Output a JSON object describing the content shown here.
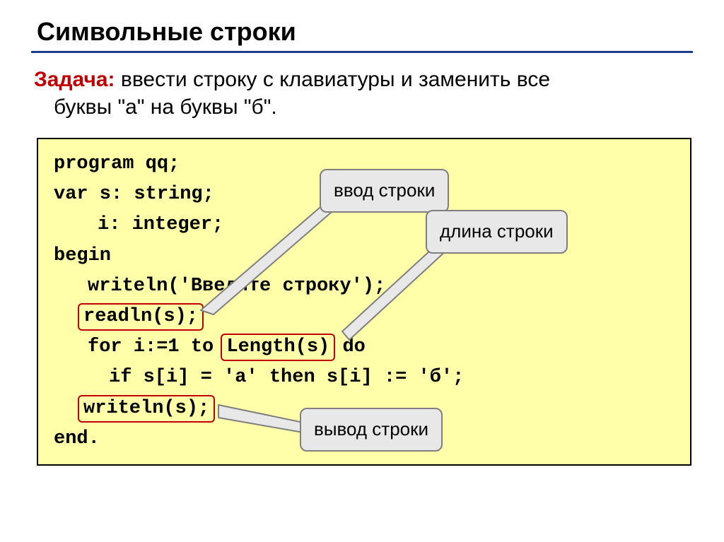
{
  "title": "Символьные строки",
  "task": {
    "label": "Задача:",
    "line1": " ввести строку с клавиатуры и заменить все",
    "line2": "буквы \"а\" на буквы \"б\"."
  },
  "code": {
    "l1": "program qq;",
    "l2": "var s: string;",
    "l3": "i: integer;",
    "l4": "begin",
    "l5": "writeln('Введите строку');",
    "l6": "readln(s);",
    "l7a": "for i:=1 to ",
    "l7b": "Length(s)",
    "l7c": " do",
    "l8": "if s[i] = 'а' then s[i] := 'б';",
    "l9": "writeln(s);",
    "l10": "end."
  },
  "callouts": {
    "input": "ввод строки",
    "length": "длина строки",
    "output": "вывод строки"
  }
}
